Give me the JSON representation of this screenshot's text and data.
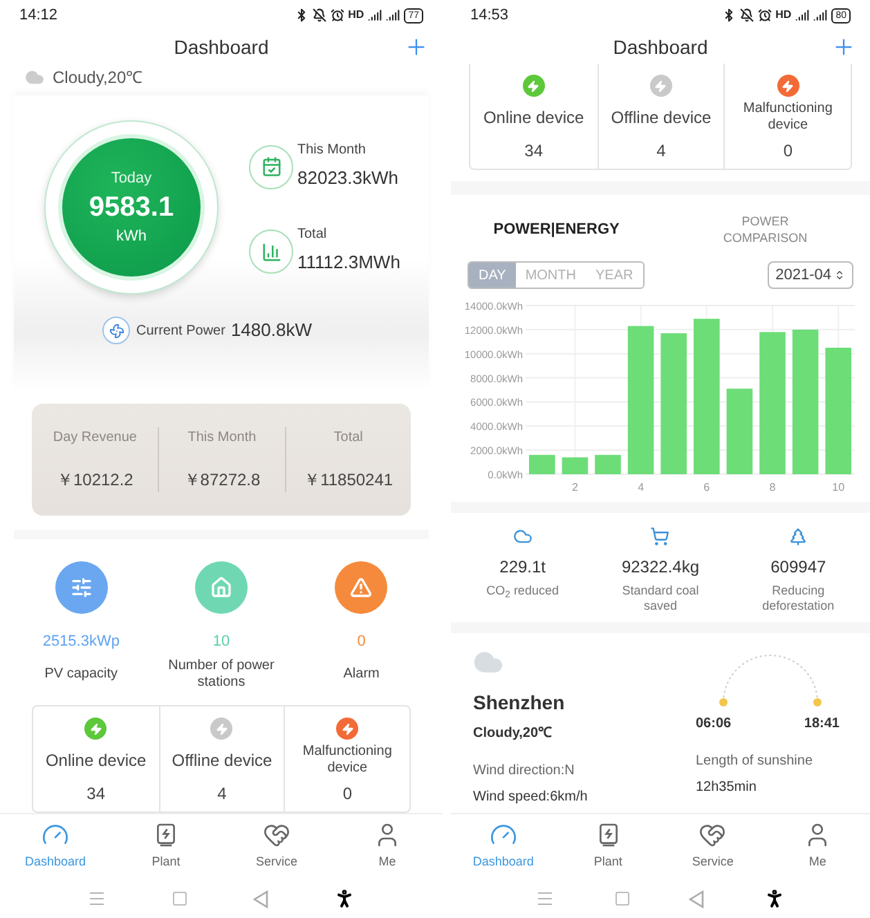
{
  "left_screen": {
    "status_bar": {
      "time": "14:12",
      "indicator": "HD",
      "battery": "77"
    },
    "header": {
      "title": "Dashboard"
    },
    "weather": "Cloudy,20℃",
    "today": {
      "label": "Today",
      "value": "9583.1",
      "unit": "kWh"
    },
    "stats": [
      {
        "kind": "month",
        "label": "This Month",
        "value": "82023.3kWh"
      },
      {
        "kind": "total",
        "label": "Total",
        "value": "11112.3MWh"
      }
    ],
    "current_power": {
      "label": "Current Power",
      "value": "1480.8kW"
    },
    "revenue": [
      {
        "label": "Day Revenue",
        "value": "￥10212.2"
      },
      {
        "label": "This Month",
        "value": "￥87272.8"
      },
      {
        "label": "Total",
        "value": "￥11850241"
      }
    ],
    "summary": [
      {
        "kind": "capacity",
        "value": "2515.3kWp",
        "label": "PV capacity",
        "color": "#6aa7f0"
      },
      {
        "kind": "stations",
        "value": "10",
        "label": "Number of power stations",
        "color": "#6fd8b2"
      },
      {
        "kind": "alarm",
        "value": "0",
        "label": "Alarm",
        "color": "#f58a3c"
      }
    ],
    "devices": [
      {
        "label": "Online device",
        "value": "34",
        "color": "#5cc83a"
      },
      {
        "label": "Offline device",
        "value": "4",
        "color": "#c9c9c9"
      },
      {
        "label": "Malfunctioning device",
        "value": "0",
        "color": "#f26a36"
      }
    ],
    "nav": [
      {
        "kind": "dashboard",
        "label": "Dashboard",
        "selected": true
      },
      {
        "kind": "plant",
        "label": "Plant",
        "selected": false
      },
      {
        "kind": "service",
        "label": "Service",
        "selected": false
      },
      {
        "kind": "me",
        "label": "Me",
        "selected": false
      }
    ]
  },
  "right_screen": {
    "status_bar": {
      "time": "14:53",
      "indicator": "HD",
      "battery": "80"
    },
    "header": {
      "title": "Dashboard"
    },
    "devices": [
      {
        "label": "Online device",
        "value": "34",
        "color": "#5cc83a"
      },
      {
        "label": "Offline device",
        "value": "4",
        "color": "#c9c9c9"
      },
      {
        "label": "Malfunctioning device",
        "value": "0",
        "color": "#f26a36"
      }
    ],
    "chart_tabs": [
      {
        "label": "POWER|ENERGY",
        "selected": true
      },
      {
        "label": "POWER COMPARISON",
        "selected": false
      }
    ],
    "periods": [
      {
        "label": "DAY",
        "selected": true
      },
      {
        "label": "MONTH",
        "selected": false
      },
      {
        "label": "YEAR",
        "selected": false
      }
    ],
    "month_select": "2021-04",
    "chart_data": {
      "type": "bar",
      "x": [
        1,
        2,
        3,
        4,
        5,
        6,
        7,
        8,
        9,
        10
      ],
      "series": [
        {
          "color": "#6ddd78",
          "values": [
            1600,
            1400,
            1600,
            12300,
            11700,
            12900,
            7100,
            11800,
            12000,
            10500
          ]
        }
      ],
      "xlim": [
        0.5,
        10.5
      ],
      "ylim": [
        0,
        14000
      ],
      "grid": true,
      "yticks": [
        {
          "value": 0,
          "label": "0.0kWh"
        },
        {
          "value": 2000,
          "label": "2000.0kWh"
        },
        {
          "value": 4000,
          "label": "4000.0kWh"
        },
        {
          "value": 6000,
          "label": "6000.0kWh"
        },
        {
          "value": 8000,
          "label": "8000.0kWh"
        },
        {
          "value": 10000,
          "label": "10000.0kWh"
        },
        {
          "value": 12000,
          "label": "12000.0kWh"
        },
        {
          "value": 14000,
          "label": "14000.0kWh"
        }
      ],
      "xticks": [
        2,
        4,
        6,
        8,
        10
      ]
    },
    "environment": [
      {
        "kind": "co2",
        "value": "229.1t",
        "label": "CO$_{2}$ reduced"
      },
      {
        "kind": "coal",
        "value": "92322.4kg",
        "label": "Standard coal saved"
      },
      {
        "kind": "tree",
        "value": "609947",
        "label": "Reducing deforestation"
      }
    ],
    "weather": {
      "city": "Shenzhen",
      "condition": "Cloudy,20℃",
      "wind_direction": "Wind direction:N",
      "wind_speed": "Wind speed:6km/h",
      "sunrise": "06:06",
      "sunset": "18:41",
      "sunshine_label": "Length of sunshine",
      "sunshine": "12h35min"
    },
    "nav": [
      {
        "kind": "dashboard",
        "label": "Dashboard",
        "selected": true
      },
      {
        "kind": "plant",
        "label": "Plant",
        "selected": false
      },
      {
        "kind": "service",
        "label": "Service",
        "selected": false
      },
      {
        "kind": "me",
        "label": "Me",
        "selected": false
      }
    ]
  }
}
